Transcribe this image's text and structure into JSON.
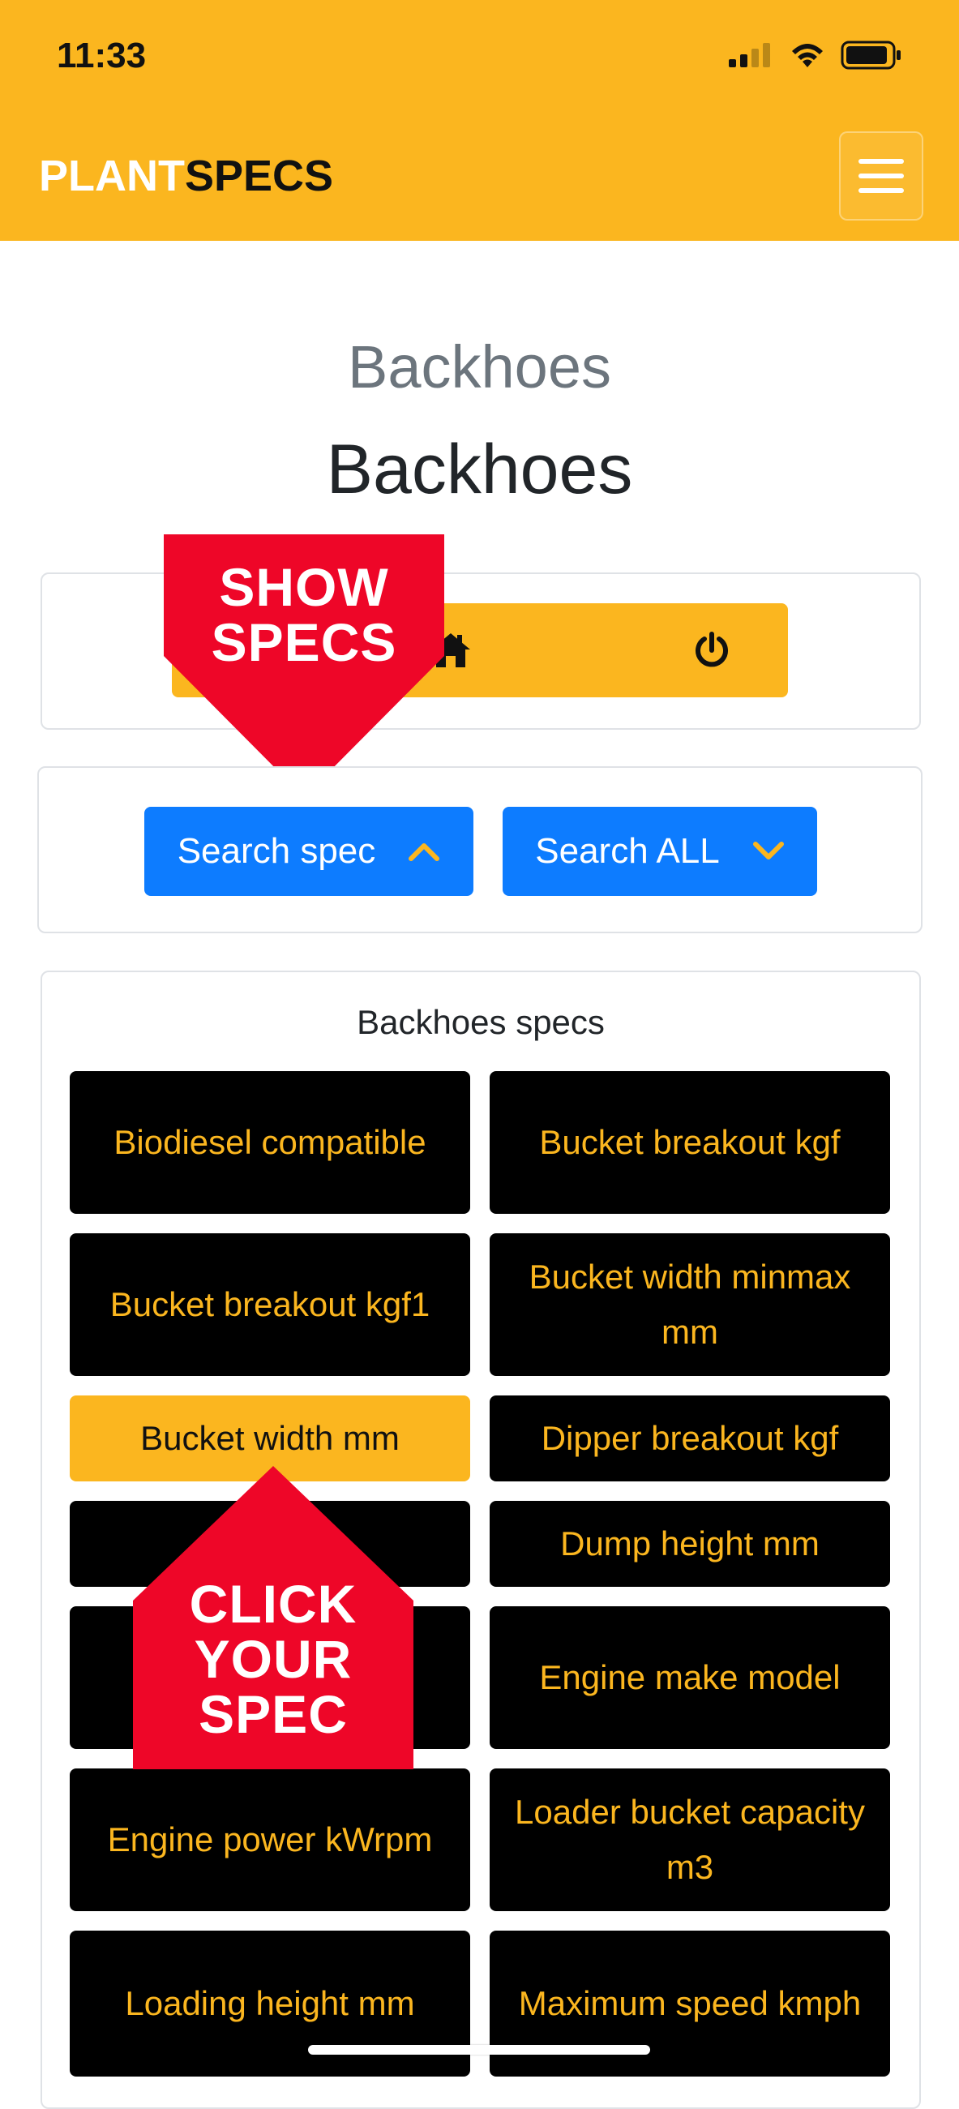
{
  "status_bar": {
    "time": "11:33"
  },
  "navbar": {
    "brand_part1": "PLANT",
    "brand_part2": "SPECS",
    "menu_icon": "hamburger-icon"
  },
  "page": {
    "subtitle": "Backhoes",
    "title": "Backhoes"
  },
  "toolbar": {
    "home_icon": "home-icon",
    "power_icon": "power-icon"
  },
  "search": {
    "spec_label": "Search spec",
    "all_label": "Search ALL"
  },
  "overlays": {
    "show_specs": [
      "SHOW",
      "SPECS"
    ],
    "click_your_spec": [
      "CLICK",
      "YOUR",
      "SPEC"
    ]
  },
  "specs": {
    "title": "Backhoes specs",
    "items": [
      "Biodiesel compatible",
      "Bucket breakout kgf",
      "Bucket breakout kgf1",
      "Bucket width minmax mm",
      "Bucket width mm",
      "Dipper breakout kgf",
      "",
      "Dump height mm",
      "",
      "Engine make model",
      "Engine power kWrpm",
      "Loader bucket capacity m3",
      "Loading height mm",
      "Maximum speed kmph"
    ]
  },
  "colors": {
    "accent": "#fbb61f",
    "primary": "#0d7cff",
    "overlay": "#ee0628"
  }
}
